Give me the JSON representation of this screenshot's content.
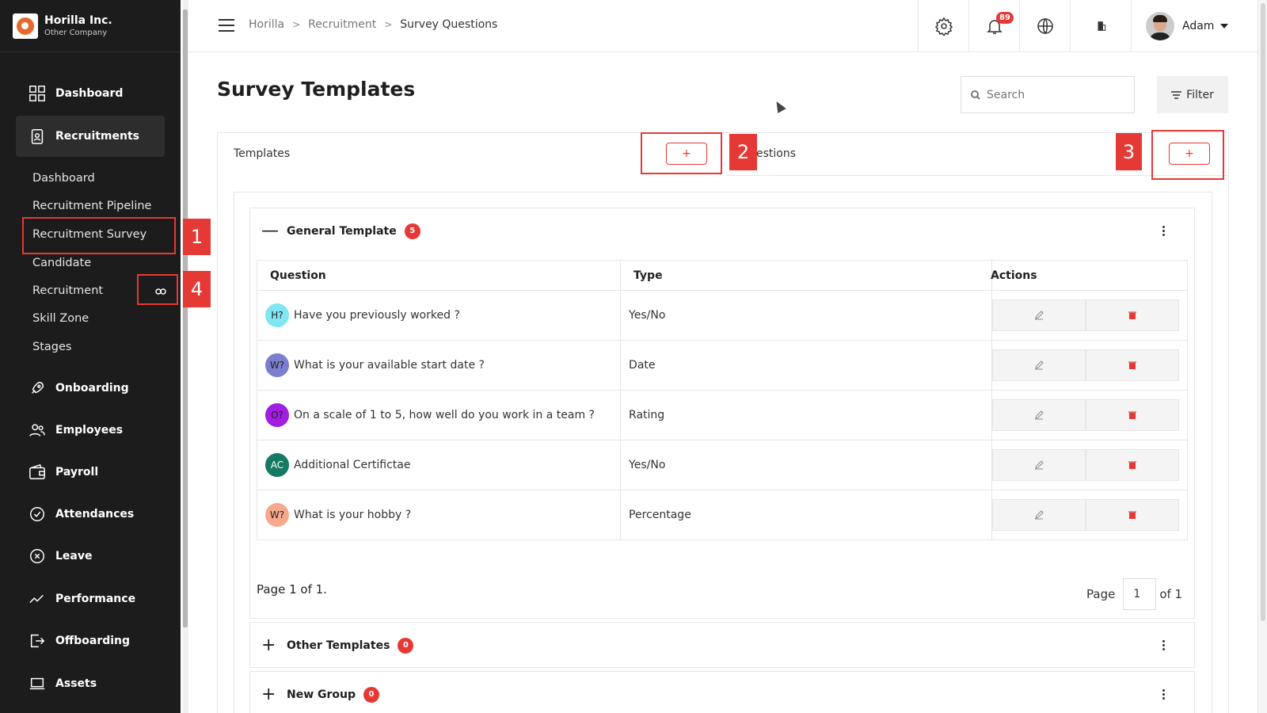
{
  "brand": {
    "name": "Horilla Inc.",
    "subtitle": "Other Company"
  },
  "sidebar": {
    "dashboard": "Dashboard",
    "recruitments": "Recruitments",
    "sub_items": [
      "Dashboard",
      "Recruitment Pipeline",
      "Recruitment Survey",
      "Candidate",
      "Recruitment",
      "Skill Zone",
      "Stages"
    ],
    "onboarding": "Onboarding",
    "employees": "Employees",
    "payroll": "Payroll",
    "attendances": "Attendances",
    "leave": "Leave",
    "performance": "Performance",
    "offboarding": "Offboarding",
    "assets": "Assets"
  },
  "breadcrumb": [
    "Horilla",
    "Recruitment",
    "Survey Questions"
  ],
  "topbar": {
    "notifications": "89",
    "user_name": "Adam"
  },
  "page": {
    "title": "Survey Templates",
    "search_placeholder": "Search",
    "filter_label": "Filter"
  },
  "tabs": {
    "templates": "Templates",
    "questions_partial": "estions",
    "add": "+"
  },
  "annotations": {
    "one": "1",
    "two": "2",
    "three": "3",
    "four": "4"
  },
  "groups": [
    {
      "name": "General Template",
      "count": "5",
      "toggle": "—"
    },
    {
      "name": "Other Templates",
      "count": "0",
      "toggle": "+"
    },
    {
      "name": "New Group",
      "count": "0",
      "toggle": "+"
    }
  ],
  "table": {
    "headers": [
      "Question",
      "Type",
      "Actions"
    ],
    "rows": [
      {
        "initials": "H?",
        "color": "#7fe6f2",
        "question": "Have you previously worked ?",
        "type": "Yes/No"
      },
      {
        "initials": "W?",
        "color": "#7b7fcf",
        "question": "What is your available start date ?",
        "type": "Date"
      },
      {
        "initials": "O?",
        "color": "#a21ee0",
        "question": "On a scale of 1 to 5, how well do you work in a team ?",
        "type": "Rating"
      },
      {
        "initials": "AC",
        "color": "#157a63",
        "question": "Additional Certifictae",
        "type": "Yes/No"
      },
      {
        "initials": "W?",
        "color": "#f6a98a",
        "question": "What is your hobby ?",
        "type": "Percentage"
      }
    ]
  },
  "pagination": {
    "info": "Page 1 of 1.",
    "page_label": "Page",
    "current": "1",
    "of_label": "of 1"
  },
  "colors": {
    "accent": "#e53935",
    "sidebar": "#1c1c1c"
  }
}
